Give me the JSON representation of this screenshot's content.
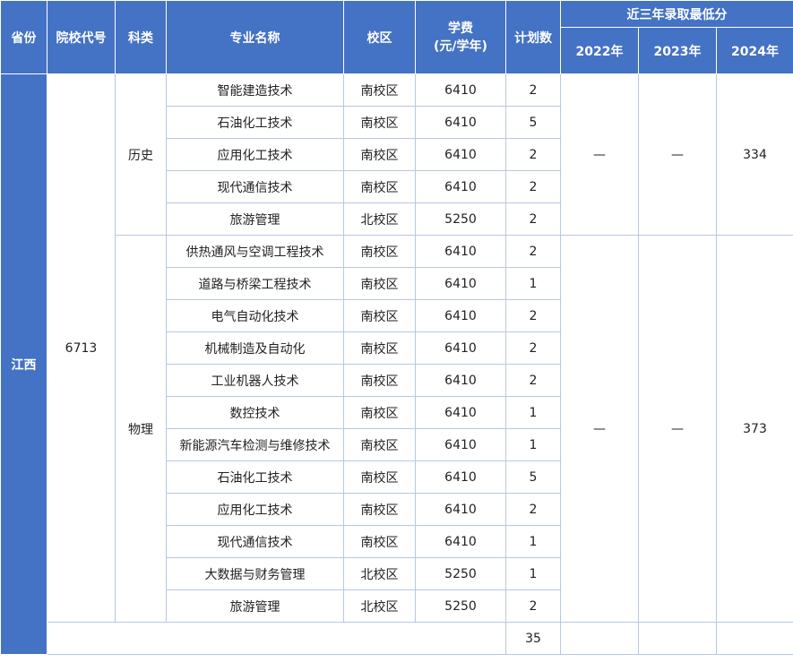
{
  "headers": {
    "province": "省份",
    "school_code": "院校代号",
    "subject": "科类",
    "major": "专业名称",
    "campus": "校区",
    "tuition": "学费\n(元/学年)",
    "plan": "计划数",
    "min_score_group": "近三年录取最低分",
    "years": [
      "2022年",
      "2023年",
      "2024年"
    ]
  },
  "province": "江西",
  "school_code": "6713",
  "groups": [
    {
      "subject": "历史",
      "scores": [
        "—",
        "—",
        "334"
      ],
      "rows": [
        {
          "major": "智能建造技术",
          "campus": "南校区",
          "tuition": "6410",
          "plan": "2"
        },
        {
          "major": "石油化工技术",
          "campus": "南校区",
          "tuition": "6410",
          "plan": "5"
        },
        {
          "major": "应用化工技术",
          "campus": "南校区",
          "tuition": "6410",
          "plan": "2"
        },
        {
          "major": "现代通信技术",
          "campus": "南校区",
          "tuition": "6410",
          "plan": "2"
        },
        {
          "major": "旅游管理",
          "campus": "北校区",
          "tuition": "5250",
          "plan": "2"
        }
      ]
    },
    {
      "subject": "物理",
      "scores": [
        "—",
        "—",
        "373"
      ],
      "rows": [
        {
          "major": "供热通风与空调工程技术",
          "campus": "南校区",
          "tuition": "6410",
          "plan": "2"
        },
        {
          "major": "道路与桥梁工程技术",
          "campus": "南校区",
          "tuition": "6410",
          "plan": "1"
        },
        {
          "major": "电气自动化技术",
          "campus": "南校区",
          "tuition": "6410",
          "plan": "2"
        },
        {
          "major": "机械制造及自动化",
          "campus": "南校区",
          "tuition": "6410",
          "plan": "2"
        },
        {
          "major": "工业机器人技术",
          "campus": "南校区",
          "tuition": "6410",
          "plan": "2"
        },
        {
          "major": "数控技术",
          "campus": "南校区",
          "tuition": "6410",
          "plan": "1"
        },
        {
          "major": "新能源汽车检测与维修技术",
          "campus": "南校区",
          "tuition": "6410",
          "plan": "1"
        },
        {
          "major": "石油化工技术",
          "campus": "南校区",
          "tuition": "6410",
          "plan": "5"
        },
        {
          "major": "应用化工技术",
          "campus": "南校区",
          "tuition": "6410",
          "plan": "2"
        },
        {
          "major": "现代通信技术",
          "campus": "南校区",
          "tuition": "6410",
          "plan": "1"
        },
        {
          "major": "大数据与财务管理",
          "campus": "北校区",
          "tuition": "5250",
          "plan": "1"
        },
        {
          "major": "旅游管理",
          "campus": "北校区",
          "tuition": "5250",
          "plan": "2"
        }
      ]
    }
  ],
  "total_plan": "35",
  "colors": {
    "header_bg": "#4472c4",
    "header_text": "#ffffff",
    "grid": "#b7c7e3"
  }
}
